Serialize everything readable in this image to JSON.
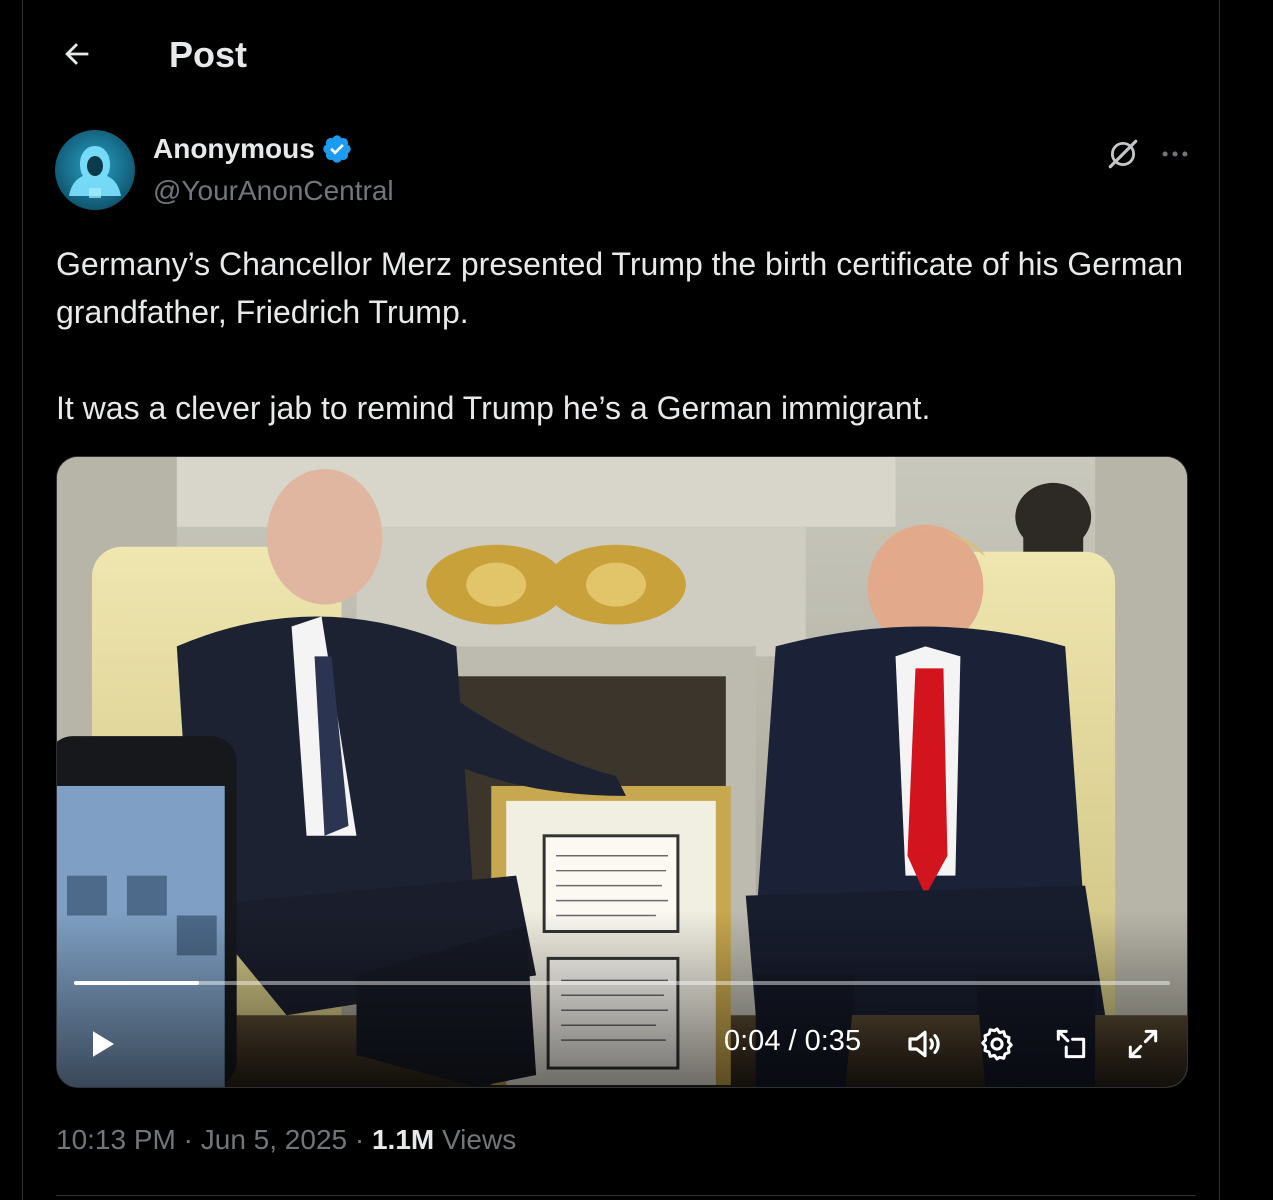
{
  "header": {
    "title": "Post",
    "back_icon": "arrow-left-icon"
  },
  "author": {
    "display_name": "Anonymous",
    "handle": "@YourAnonCentral",
    "verified": true,
    "badge_color": "#1d9bf0",
    "avatar_icon": "hooded-figure-avatar"
  },
  "post": {
    "paragraphs": [
      "Germany’s Chancellor Merz presented Trump the birth certificate of his German grandfather, Friedrich Trump.",
      "It was a clever jab to remind Trump he’s a German immigrant."
    ]
  },
  "video": {
    "current_time": "0:04",
    "separator": " / ",
    "duration": "0:35",
    "progress_fraction": 0.114,
    "controls": [
      "play-icon",
      "volume-icon",
      "settings-gear-icon",
      "dock-icon",
      "fullscreen-icon"
    ]
  },
  "meta": {
    "time": "10:13 PM",
    "date": "Jun 5, 2025",
    "views_count": "1.1M",
    "views_label": "Views",
    "sep": " · "
  },
  "colors": {
    "background": "#000000",
    "text": "#e7e9ea",
    "secondary": "#71767b",
    "border": "#2f3336",
    "accent": "#1d9bf0"
  }
}
